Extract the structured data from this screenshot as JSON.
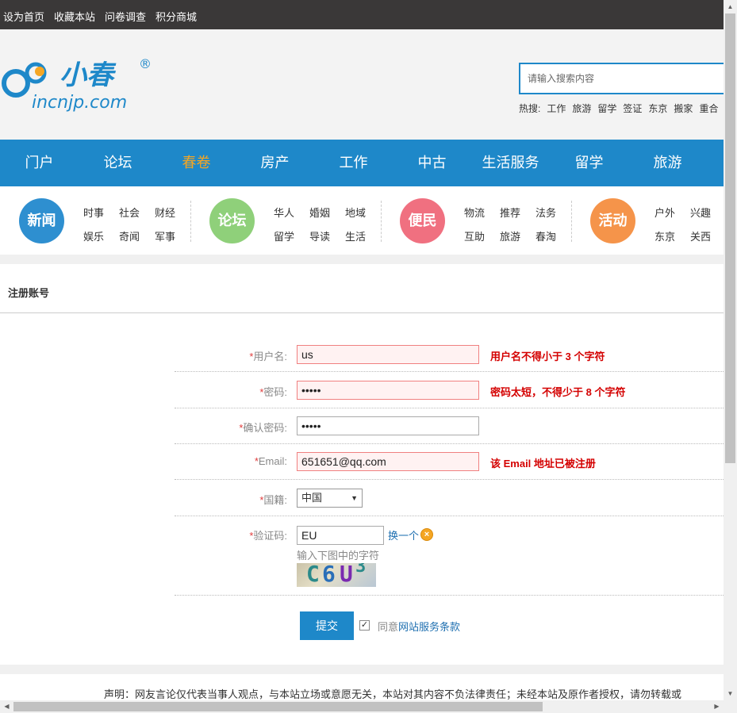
{
  "topbar": {
    "links": [
      "设为首页",
      "收藏本站",
      "问卷调查",
      "积分商城"
    ]
  },
  "logo": {
    "name": "小春",
    "domain": "incnjp.com",
    "registered": "®"
  },
  "search": {
    "placeholder": "请输入搜索内容",
    "hot_label": "热搜:",
    "hot_items": [
      "工作",
      "旅游",
      "留学",
      "签证",
      "东京",
      "搬家",
      "重合"
    ]
  },
  "nav": {
    "items": [
      "门户",
      "论坛",
      "春卷",
      "房产",
      "工作",
      "中古",
      "生活服务",
      "留学",
      "旅游"
    ],
    "active_index": 2,
    "active_color": "#f5a623",
    "bg_color": "#1e88c9"
  },
  "categories": [
    {
      "label": "新闻",
      "color": "#2e8fd0",
      "links": [
        "时事",
        "社会",
        "财经",
        "娱乐",
        "奇闻",
        "军事"
      ]
    },
    {
      "label": "论坛",
      "color": "#8fd07a",
      "links": [
        "华人",
        "婚姻",
        "地域",
        "留学",
        "导读",
        "生活"
      ]
    },
    {
      "label": "便民",
      "color": "#f07080",
      "links": [
        "物流",
        "推荐",
        "法务",
        "互助",
        "旅游",
        "春淘"
      ]
    },
    {
      "label": "活动",
      "color": "#f5944a",
      "links": [
        "户外",
        "兴趣",
        "东京",
        "关西"
      ]
    }
  ],
  "form": {
    "title": "注册账号",
    "required_mark": "*",
    "username": {
      "label": "用户名:",
      "value": "us",
      "error": "用户名不得小于 3 个字符"
    },
    "password": {
      "label": "密码:",
      "value": "•••••",
      "error": "密码太短，不得少于 8 个字符"
    },
    "confirm": {
      "label": "确认密码:",
      "value": "•••••"
    },
    "email": {
      "label": "Email:",
      "value": "651651@qq.com",
      "error": "该 Email 地址已被注册"
    },
    "country": {
      "label": "国籍:",
      "value": "中国"
    },
    "captcha": {
      "label": "验证码:",
      "value": "EU",
      "change": "换一个",
      "hint": "输入下图中的字符",
      "image_text": "C6U3"
    },
    "submit": "提交",
    "agree_checked": true,
    "agree_prefix": "同意",
    "agree_link": "网站服务条款"
  },
  "footer": {
    "notice": "声明：网友言论仅代表当事人观点，与本站立场或意愿无关，本站对其内容不负法律责任；未经本站及原作者授权，请勿转载或"
  }
}
